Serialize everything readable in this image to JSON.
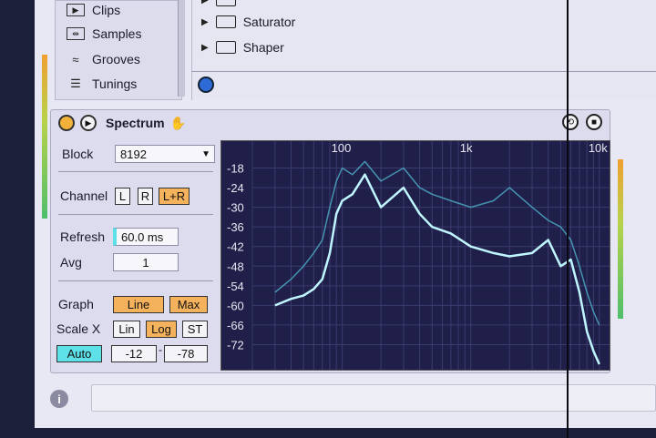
{
  "browser": {
    "items": [
      {
        "label": "Clips",
        "icon": "clip-icon"
      },
      {
        "label": "Samples",
        "icon": "samples-icon"
      },
      {
        "label": "Grooves",
        "icon": "groove-icon"
      },
      {
        "label": "Tunings",
        "icon": "tunings-icon"
      }
    ]
  },
  "devices": {
    "items": [
      {
        "label": "Saturator"
      },
      {
        "label": "Shaper"
      }
    ]
  },
  "device": {
    "title": "Spectrum",
    "block_label": "Block",
    "block_value": "8192",
    "channel_label": "Channel",
    "channel_l": "L",
    "channel_r": "R",
    "channel_lr": "L+R",
    "refresh_label": "Refresh",
    "refresh_value": "60.0 ms",
    "avg_label": "Avg",
    "avg_value": "1",
    "graph_label": "Graph",
    "graph_line": "Line",
    "graph_max": "Max",
    "scalex_label": "Scale X",
    "scale_lin": "Lin",
    "scale_log": "Log",
    "scale_st": "ST",
    "auto_label": "Auto",
    "range_hi": "-12",
    "range_lo": "-78"
  },
  "chart_data": {
    "type": "line",
    "x_ticks": [
      "100",
      "1k",
      "10k"
    ],
    "y_ticks": [
      "-18",
      "-24",
      "-30",
      "-36",
      "-42",
      "-48",
      "-54",
      "-60",
      "-66",
      "-72"
    ],
    "ylim": [
      -78,
      -12
    ],
    "x_scale": "log",
    "grid": true,
    "colors": {
      "line": "#bff6ff",
      "max": "#4fb0c8",
      "bg": "#1f1f4a"
    },
    "series": [
      {
        "x": [
          30,
          40,
          50,
          60,
          70,
          80,
          90,
          100,
          120,
          150,
          200,
          300,
          400,
          500,
          700,
          1000,
          1500,
          2000,
          3000,
          4000,
          5000,
          6000,
          7000,
          8000,
          9000,
          10000
        ],
        "values": [
          -60,
          -58,
          -57,
          -55,
          -52,
          -44,
          -32,
          -28,
          -26,
          -20,
          -30,
          -24,
          -32,
          -36,
          -38,
          -42,
          -44,
          -45,
          -44,
          -40,
          -48,
          -46,
          -56,
          -68,
          -74,
          -78
        ]
      },
      {
        "x": [
          30,
          40,
          50,
          60,
          70,
          80,
          90,
          100,
          120,
          150,
          200,
          300,
          400,
          500,
          700,
          1000,
          1500,
          2000,
          3000,
          4000,
          5000,
          6000,
          7000,
          8000,
          9000,
          10000
        ],
        "values": [
          -56,
          -52,
          -48,
          -44,
          -40,
          -30,
          -22,
          -18,
          -20,
          -16,
          -22,
          -18,
          -24,
          -26,
          -28,
          -30,
          -28,
          -24,
          -30,
          -34,
          -36,
          -40,
          -48,
          -56,
          -62,
          -66
        ]
      }
    ]
  }
}
